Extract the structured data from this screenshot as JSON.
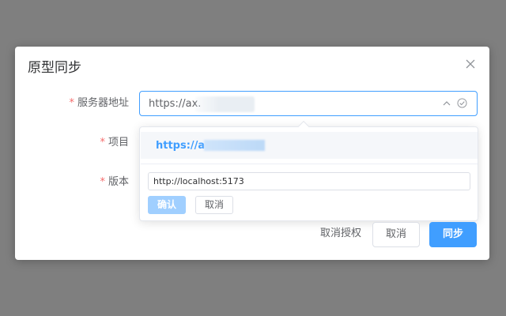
{
  "dialog": {
    "title": "原型同步"
  },
  "form": {
    "server_label": "服务器地址",
    "project_label": "项目",
    "version_label": "版本",
    "required_mark": "*",
    "server_value": "https://ax."
  },
  "dropdown": {
    "option_text": "https://ax",
    "url_input_value": "http://localhost:5173",
    "confirm_label": "确认",
    "cancel_label": "取消"
  },
  "footer": {
    "revoke_label": "取消授权",
    "cancel_label": "取消",
    "sync_label": "同步"
  },
  "icons": {
    "close": "close-icon",
    "arrow": "chevron-up-icon",
    "check": "check-circle-icon"
  },
  "colors": {
    "primary": "#409eff",
    "required": "#f56c6c",
    "overlay": "#7f7f7f"
  }
}
